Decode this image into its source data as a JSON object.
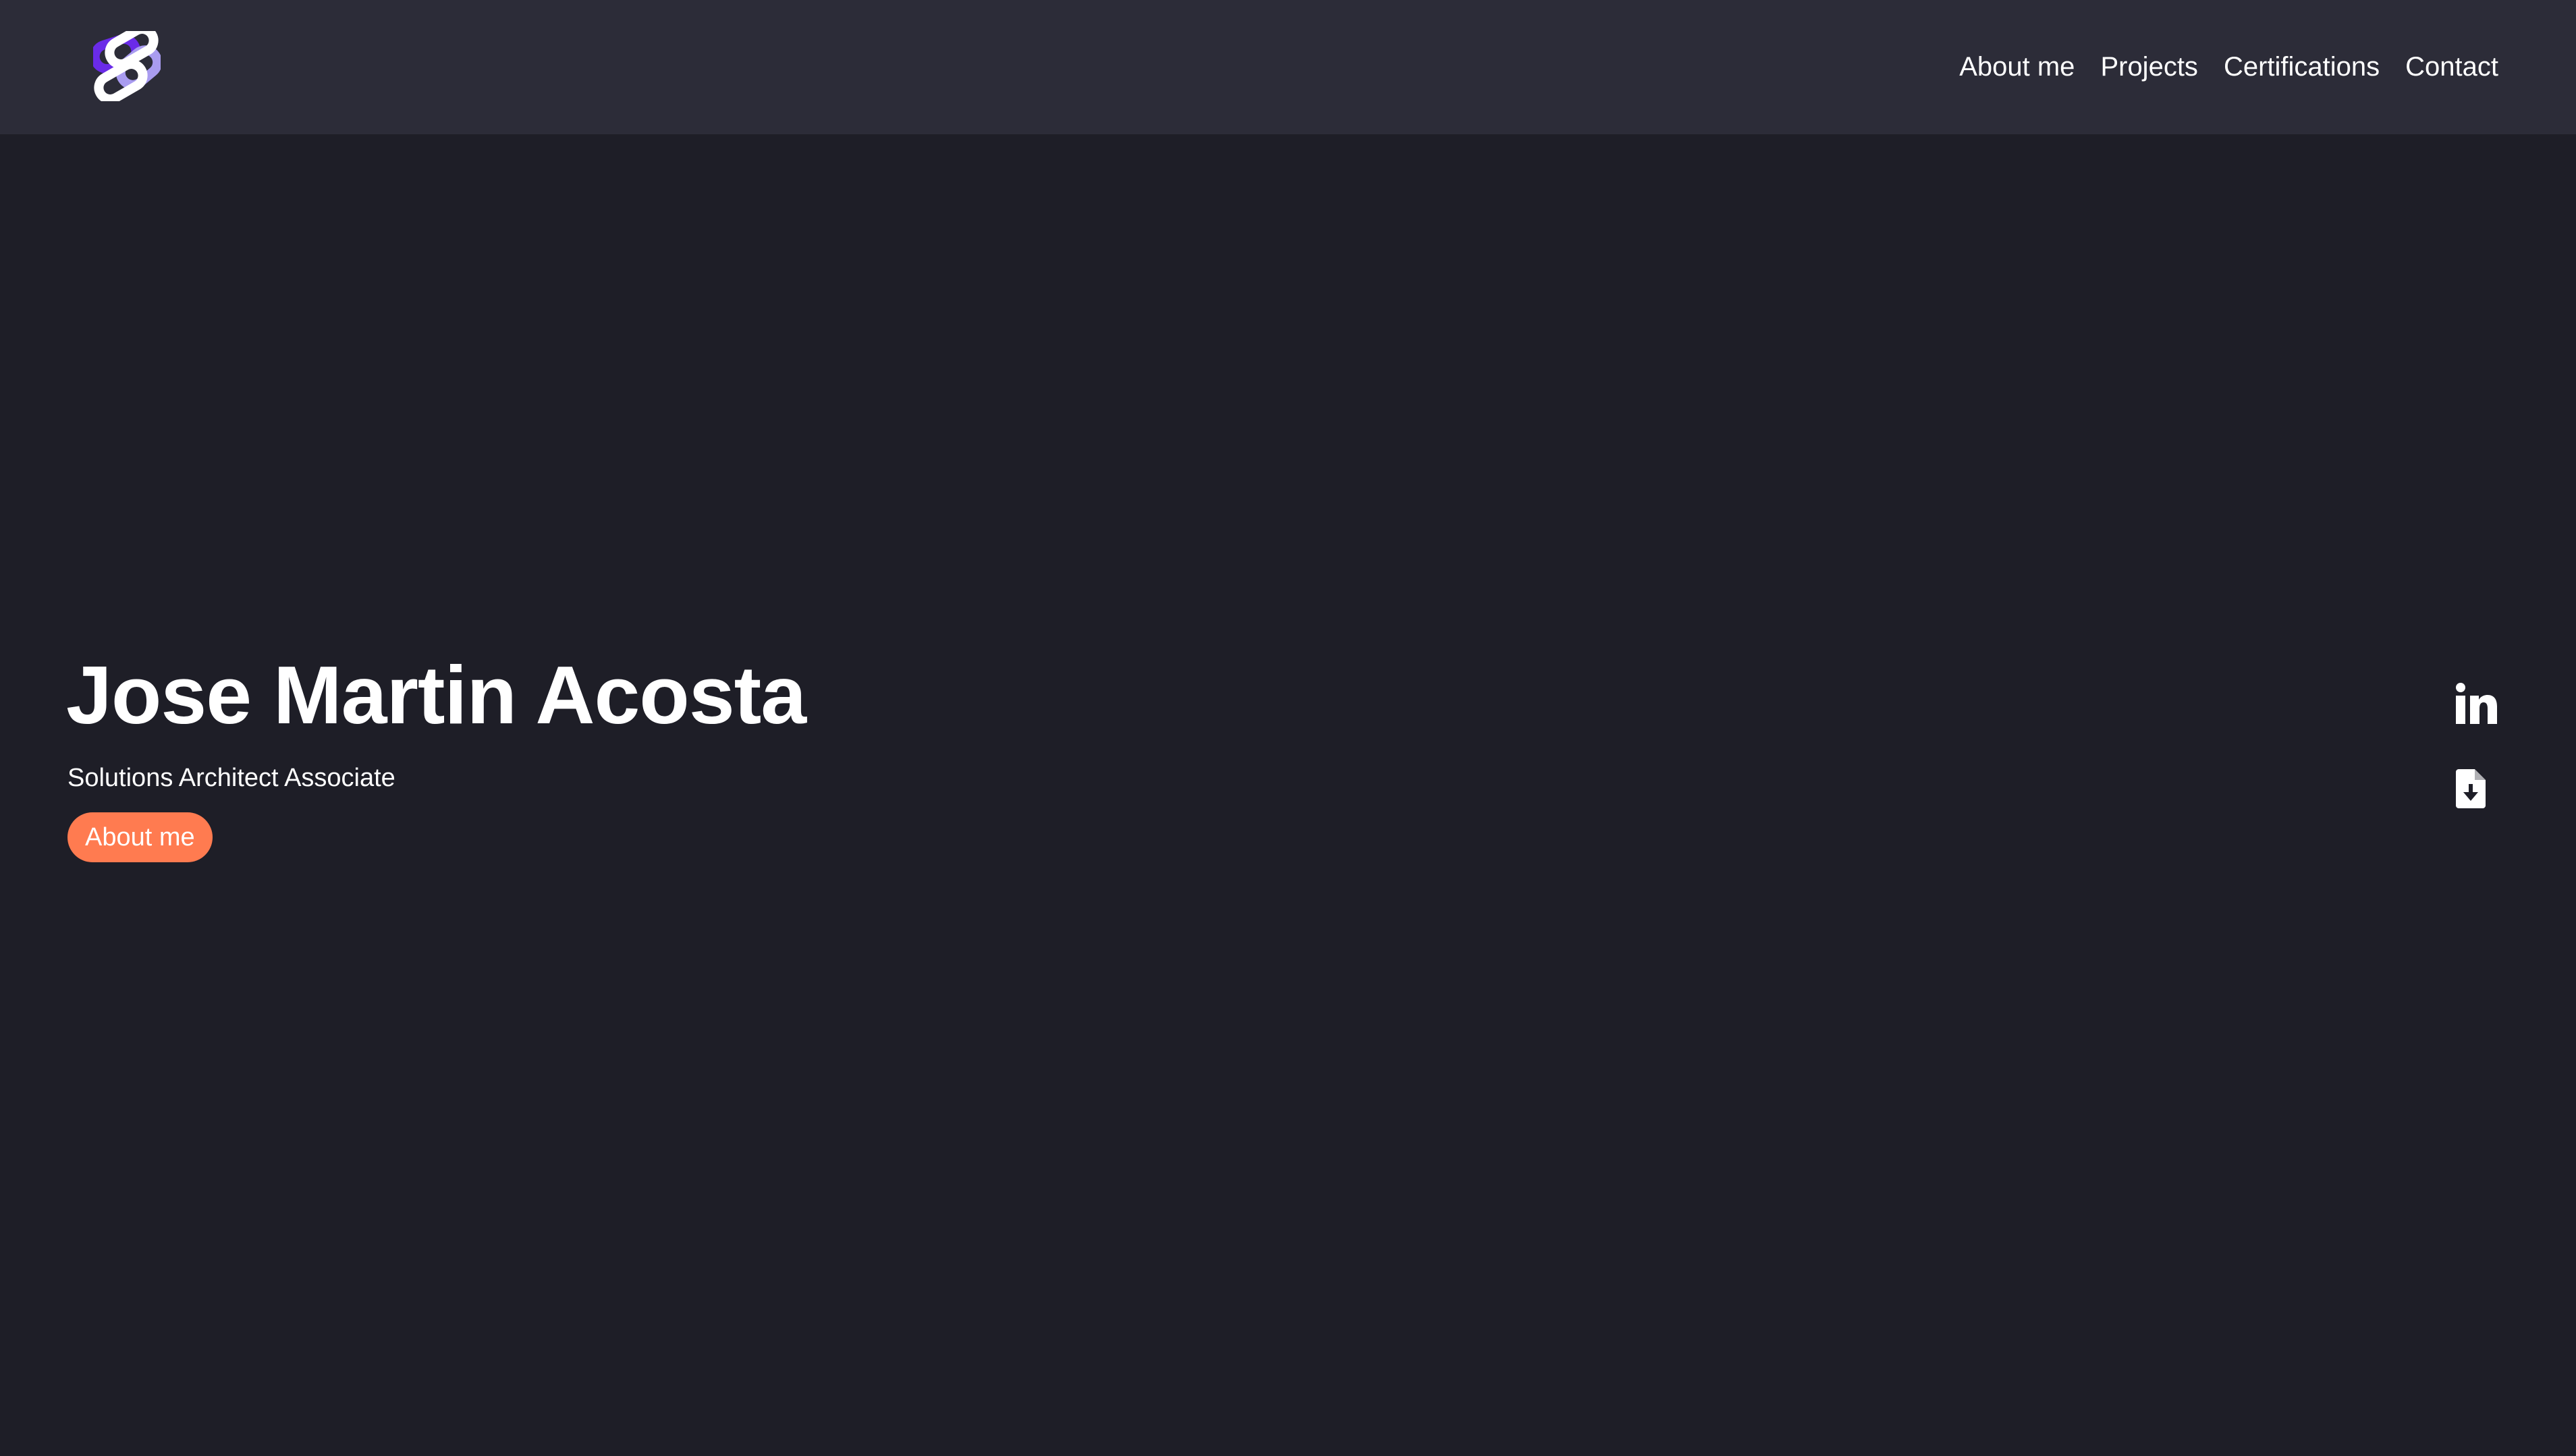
{
  "header": {
    "logo_icon": "interlinked-rings-logo-icon",
    "nav": [
      {
        "label": "About me"
      },
      {
        "label": "Projects"
      },
      {
        "label": "Certifications"
      },
      {
        "label": "Contact"
      }
    ]
  },
  "hero": {
    "name": "Jose Martin Acosta",
    "subtitle": "Solutions Architect Associate",
    "button_label": "About me"
  },
  "social": {
    "linkedin_icon": "linkedin-icon",
    "resume_icon": "file-download-icon"
  },
  "colors": {
    "background": "#1e1e27",
    "header_background": "#2c2c38",
    "accent": "#ff7b50",
    "logo_purple": "#6a2be8",
    "logo_lavender": "#a99cf0",
    "text": "#ffffff"
  }
}
